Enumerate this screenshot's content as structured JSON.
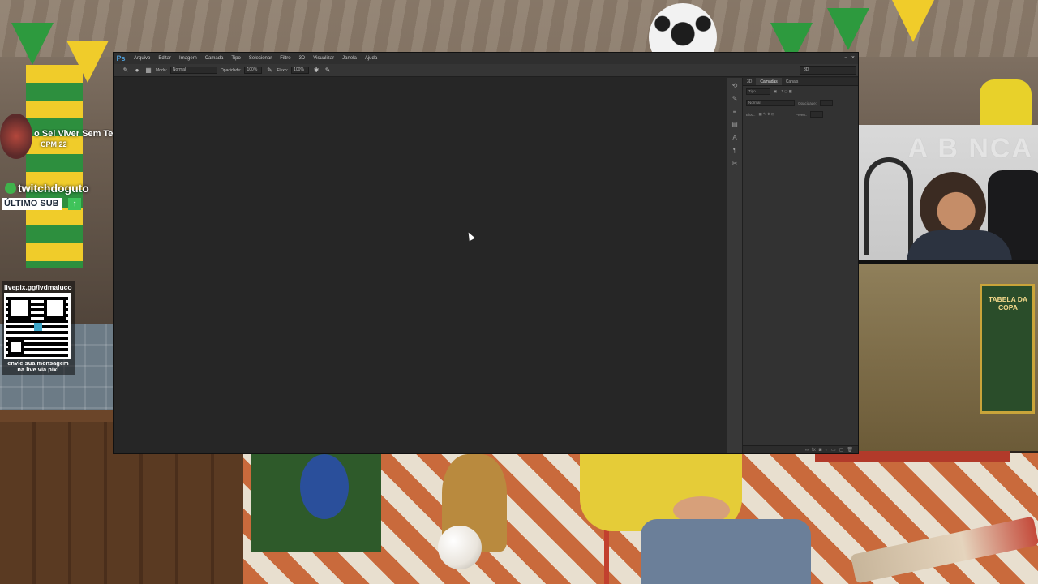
{
  "photoshop": {
    "logo": "Ps",
    "menu": [
      "Arquivo",
      "Editar",
      "Imagem",
      "Camada",
      "Tipo",
      "Selecionar",
      "Filtro",
      "3D",
      "Visualizar",
      "Janela",
      "Ajuda"
    ],
    "window_controls": {
      "minimize": "–",
      "restore": "▫",
      "close": "×"
    },
    "options_bar": {
      "mode_label": "Modo:",
      "mode_value": "Normal",
      "opacity_label": "Opacidade:",
      "opacity_value": "100%",
      "flow_label": "Fluxo:",
      "flow_value": "100%"
    },
    "workspace": "3D",
    "panel_tabs": [
      "3D",
      "Camadas",
      "Canais"
    ],
    "layers_panel": {
      "filter_placeholder": "Tipo",
      "blend_mode": "Normal",
      "opacity_label": "Opacidade:",
      "lock_label": "Bloq.:",
      "fill_label": "Preen.:"
    }
  },
  "overlay": {
    "song_title": "o Sei Viver Sem Te",
    "song_sub": "CPM 22",
    "last_sub_name": "twitchdoguto",
    "last_sub_label": "ÚLTIMO SUB",
    "pix_link": "livepix.gg/lvdmaluco",
    "pix_message": "envie sua mensagem na live via pix!",
    "copa_title": "TABELA DA COPA"
  },
  "colors": {
    "ps_bg": "#262626",
    "ps_panel": "#323232",
    "accent_green": "#3fb24b",
    "brazil_yellow": "#f0cc2a"
  }
}
